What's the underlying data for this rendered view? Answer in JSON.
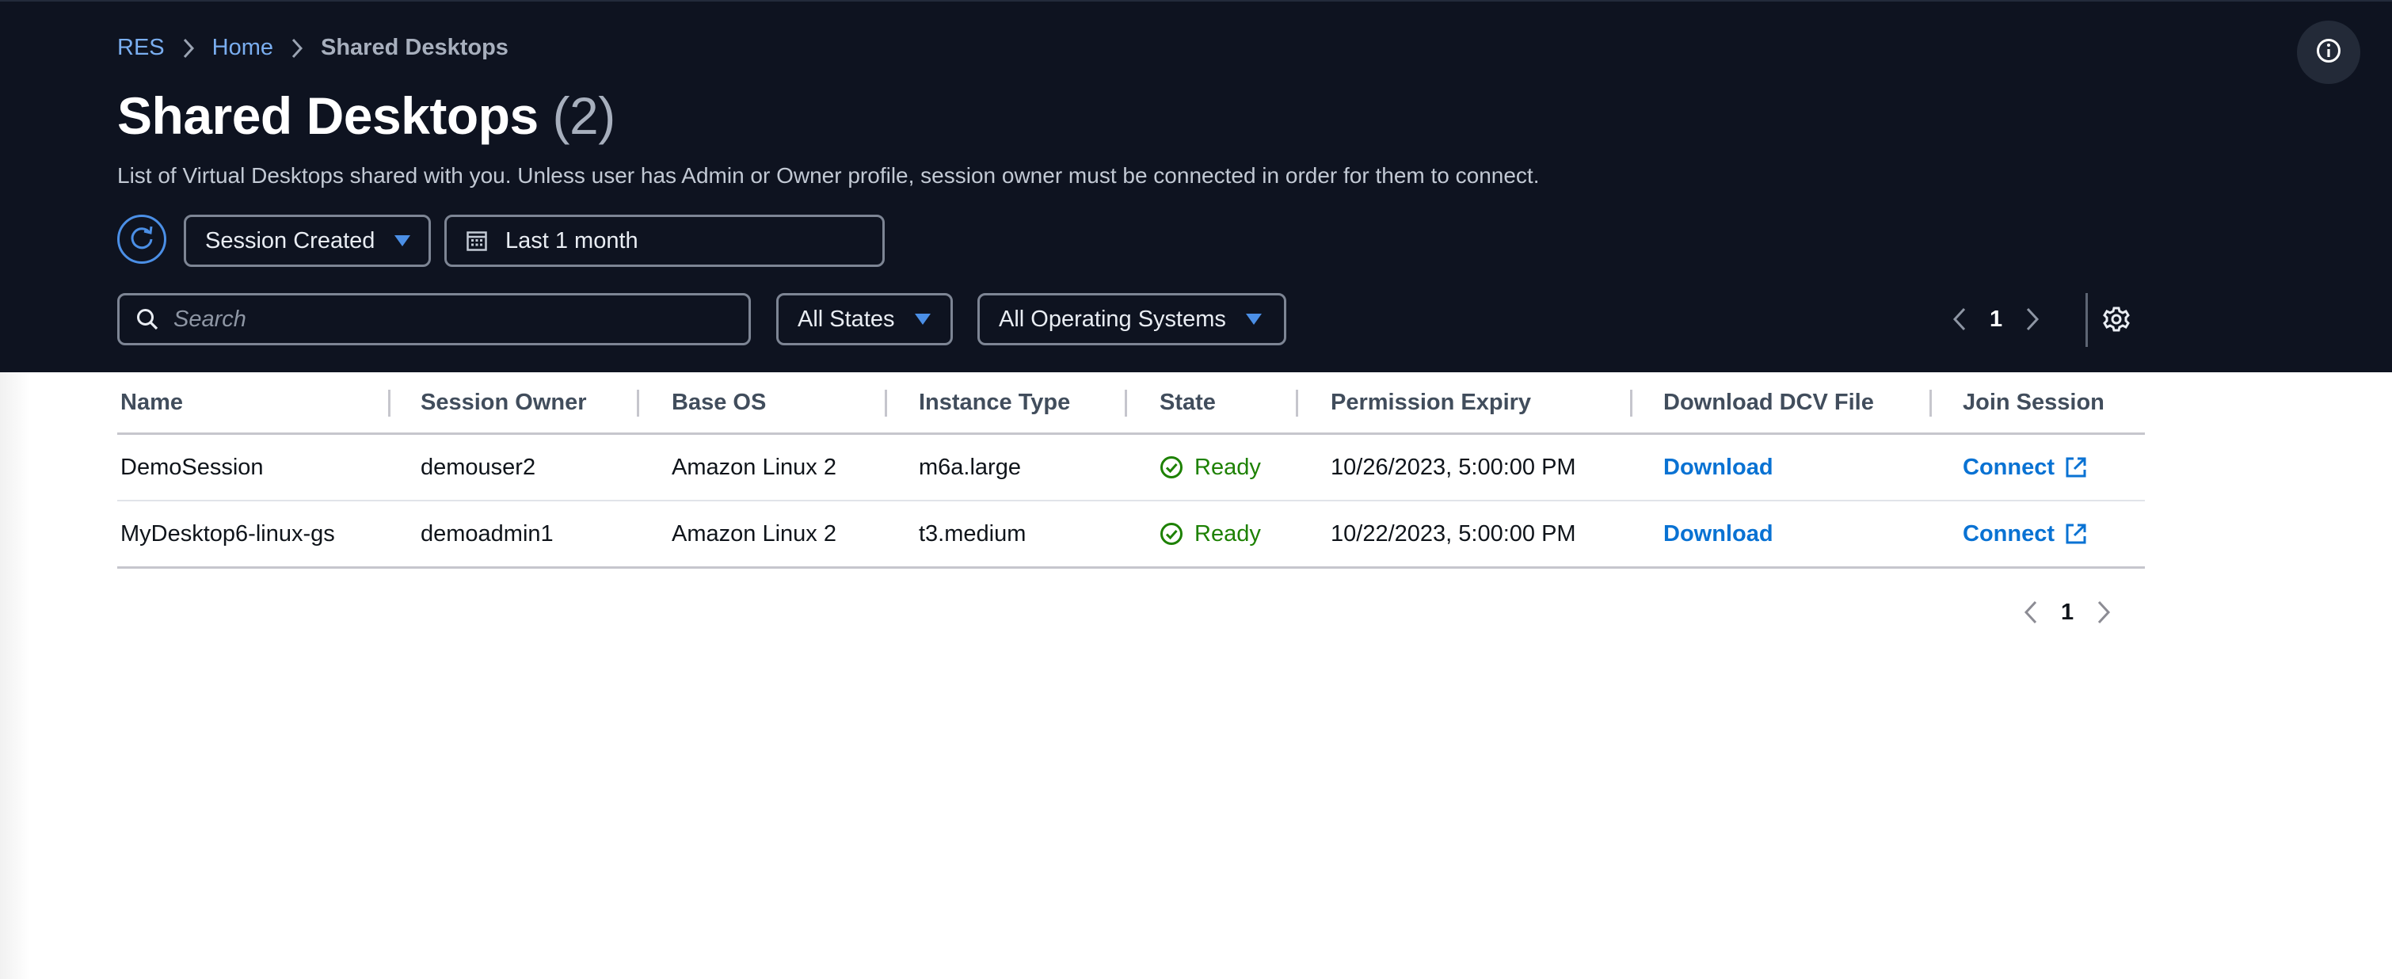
{
  "breadcrumb": {
    "items": [
      {
        "label": "RES"
      },
      {
        "label": "Home"
      },
      {
        "label": "Shared Desktops"
      }
    ]
  },
  "page": {
    "title": "Shared Desktops",
    "count": "(2)",
    "description": "List of Virtual Desktops shared with you. Unless user has Admin or Owner profile, session owner must be connected in order for them to connect."
  },
  "filters": {
    "sort_by": "Session Created",
    "date_range": "Last 1 month",
    "search_placeholder": "Search",
    "state": "All States",
    "os": "All Operating Systems"
  },
  "pagination": {
    "current_page": "1"
  },
  "table": {
    "columns": [
      "Name",
      "Session Owner",
      "Base OS",
      "Instance Type",
      "State",
      "Permission Expiry",
      "Download DCV File",
      "Join Session"
    ],
    "rows": [
      {
        "name": "DemoSession",
        "owner": "demouser2",
        "base_os": "Amazon Linux 2",
        "instance_type": "m6a.large",
        "state": "Ready",
        "permission_expiry": "10/26/2023, 5:00:00 PM",
        "download": "Download",
        "join": "Connect"
      },
      {
        "name": "MyDesktop6-linux-gs",
        "owner": "demoadmin1",
        "base_os": "Amazon Linux 2",
        "instance_type": "t3.medium",
        "state": "Ready",
        "permission_expiry": "10/22/2023, 5:00:00 PM",
        "download": "Download",
        "join": "Connect"
      }
    ]
  },
  "colors": {
    "header_bg": "#0e1320",
    "link": "#0972d3",
    "accent": "#4b8fe6",
    "ready": "#1d8102"
  },
  "icons": [
    "chevron-right-icon",
    "info-icon",
    "refresh-icon",
    "caret-down-icon",
    "calendar-icon",
    "search-icon",
    "chevron-left-icon",
    "gear-icon",
    "status-ok-icon",
    "external-link-icon"
  ]
}
